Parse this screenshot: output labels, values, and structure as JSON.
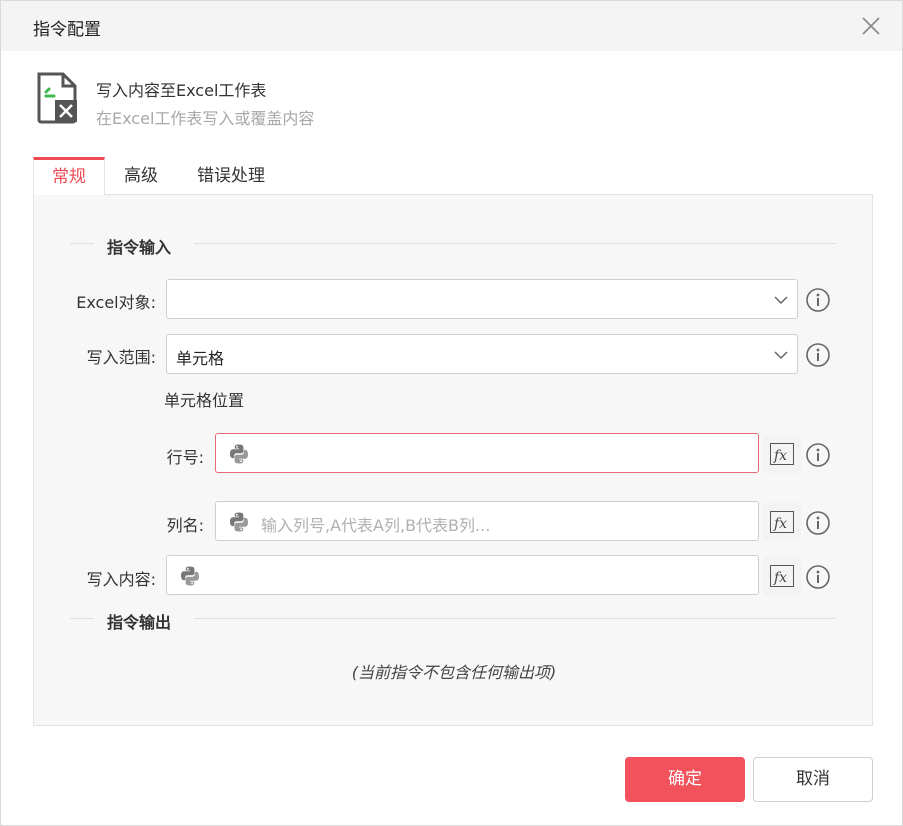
{
  "dialog": {
    "title": "指令配置"
  },
  "command": {
    "name": "写入内容至Excel工作表",
    "description": "在Excel工作表写入或覆盖内容",
    "icon": "excel-file-icon"
  },
  "tabs": [
    {
      "label": "常规",
      "active": true
    },
    {
      "label": "高级",
      "active": false
    },
    {
      "label": "错误处理",
      "active": false
    }
  ],
  "input_section": {
    "title": "指令输入",
    "excel_object": {
      "label": "Excel对象:",
      "value": ""
    },
    "write_range": {
      "label": "写入范围:",
      "value": "单元格"
    },
    "cell_position": {
      "label": "单元格位置"
    },
    "row": {
      "label": "行号:",
      "value": "",
      "placeholder": ""
    },
    "column": {
      "label": "列名:",
      "value": "",
      "placeholder": "输入列号,A代表A列,B代表B列..."
    },
    "content": {
      "label": "写入内容:",
      "value": "",
      "placeholder": ""
    }
  },
  "output_section": {
    "title": "指令输出",
    "empty_text": "(当前指令不包含任何输出项)"
  },
  "footer": {
    "ok_label": "确定",
    "cancel_label": "取消"
  },
  "colors": {
    "accent": "#f2525c",
    "error_border": "#e86b73",
    "excel_green": "#3fb84f"
  }
}
